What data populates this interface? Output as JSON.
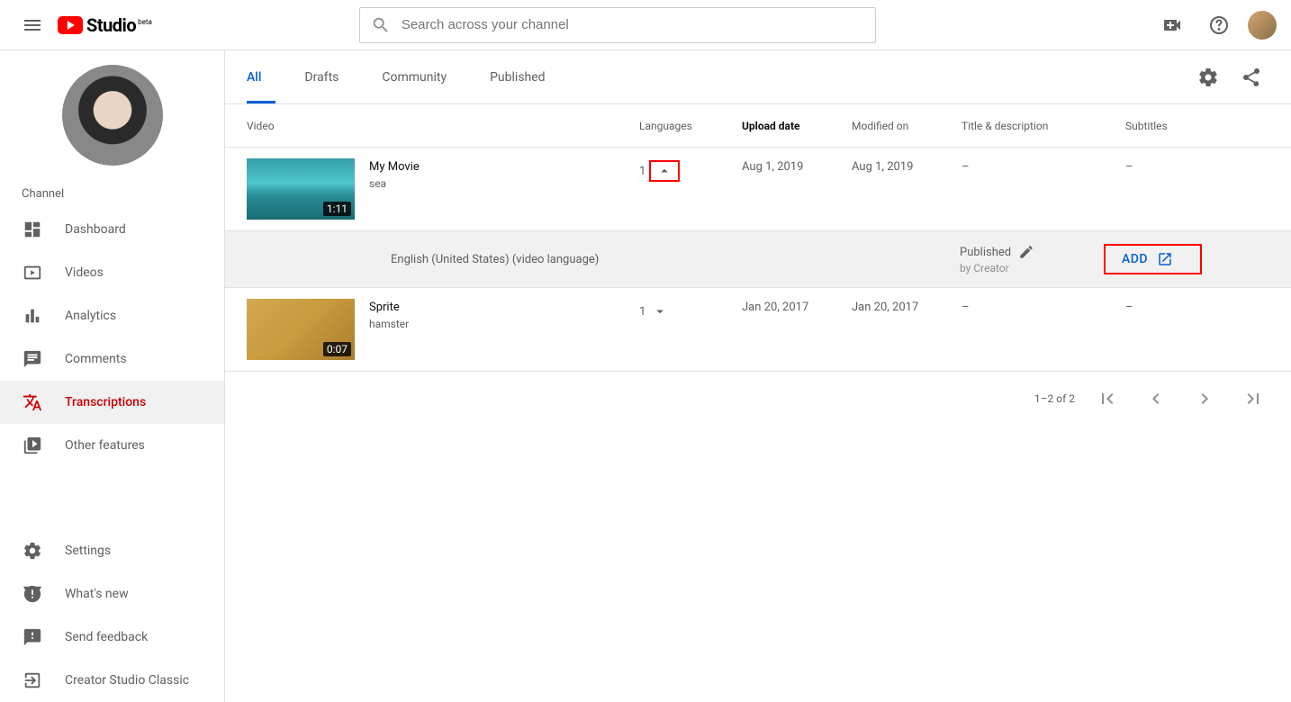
{
  "header": {
    "studio_label": "Studio",
    "beta_label": "beta",
    "search_placeholder": "Search across your channel"
  },
  "sidebar": {
    "channel_label": "Channel",
    "nav": [
      {
        "label": "Dashboard"
      },
      {
        "label": "Videos"
      },
      {
        "label": "Analytics"
      },
      {
        "label": "Comments"
      },
      {
        "label": "Transcriptions"
      },
      {
        "label": "Other features"
      }
    ],
    "bottom": [
      {
        "label": "Settings"
      },
      {
        "label": "What's new"
      },
      {
        "label": "Send feedback"
      },
      {
        "label": "Creator Studio Classic"
      }
    ]
  },
  "tabs": [
    {
      "label": "All"
    },
    {
      "label": "Drafts"
    },
    {
      "label": "Community"
    },
    {
      "label": "Published"
    }
  ],
  "columns": {
    "video": "Video",
    "languages": "Languages",
    "upload": "Upload date",
    "modified": "Modified on",
    "title_desc": "Title & description",
    "subtitles": "Subtitles"
  },
  "rows": [
    {
      "title": "My Movie",
      "desc": "sea",
      "duration": "1:11",
      "lang_count": "1",
      "upload": "Aug 1, 2019",
      "modified": "Aug 1, 2019",
      "title_desc": "–",
      "subtitles": "–"
    },
    {
      "title": "Sprite",
      "desc": "hamster",
      "duration": "0:07",
      "lang_count": "1",
      "upload": "Jan 20, 2017",
      "modified": "Jan 20, 2017",
      "title_desc": "–",
      "subtitles": "–"
    }
  ],
  "subrow": {
    "language": "English (United States) (video language)",
    "status": "Published",
    "by": "by Creator",
    "add": "ADD"
  },
  "pagination": {
    "range": "1–2 of 2"
  }
}
